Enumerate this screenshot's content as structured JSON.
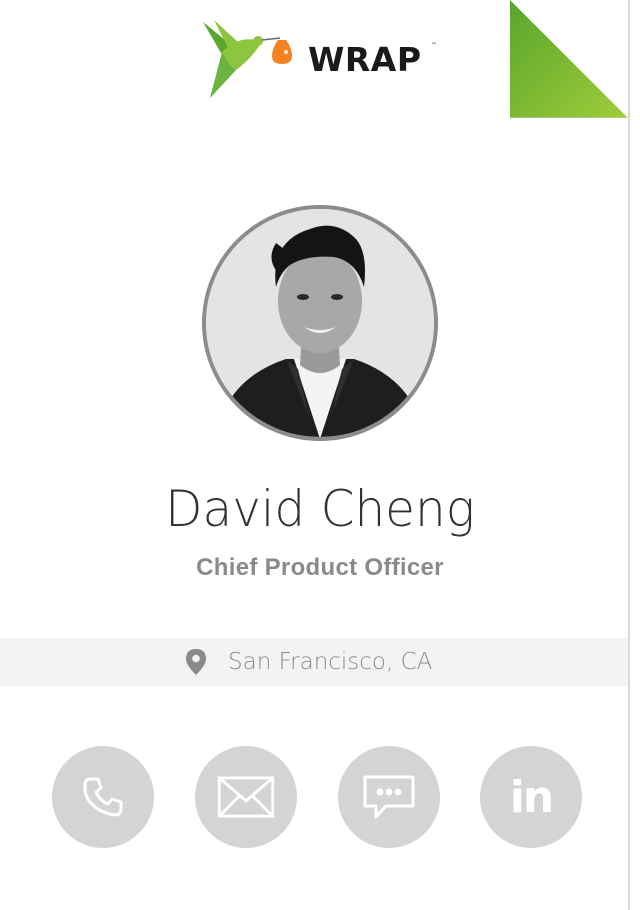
{
  "brand": {
    "logo_text": "WRAP",
    "logo_tm": "™",
    "colors": {
      "green": "#8cc63f",
      "orange": "#f58220",
      "dark": "#1a1a1a"
    }
  },
  "profile": {
    "name": "David Cheng",
    "title": "Chief Product Officer",
    "avatar_alt": "David Cheng",
    "location": "San Francisco, CA"
  },
  "actions": [
    {
      "name": "phone",
      "icon": "phone-icon"
    },
    {
      "name": "email",
      "icon": "envelope-icon"
    },
    {
      "name": "message",
      "icon": "chat-bubble-icon"
    },
    {
      "name": "linkedin",
      "icon": "linkedin-icon",
      "label": "in"
    }
  ],
  "colors": {
    "text_primary": "#333333",
    "text_secondary": "#8a8a8a",
    "location_bg": "#f3f3f3",
    "action_bg": "#d4d4d4"
  }
}
